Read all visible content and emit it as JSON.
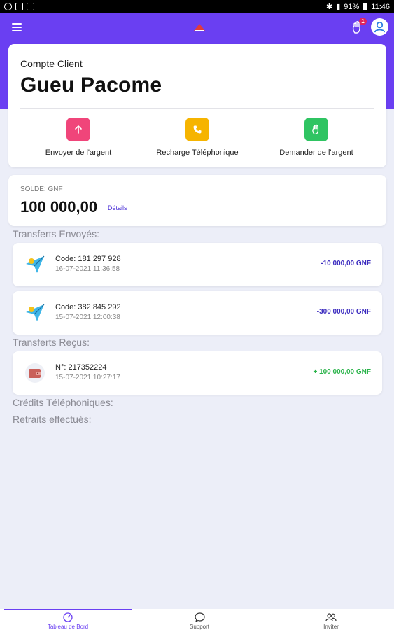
{
  "status_bar": {
    "left_icons": [
      "whatsapp-icon",
      "image-icon",
      "gmail-icon"
    ],
    "battery": "91%",
    "time": "11:46"
  },
  "header": {
    "menu_icon": "hamburger-icon",
    "logo": "app-logo",
    "notification_count": "1",
    "profile_icon": "user-icon"
  },
  "account": {
    "label": "Compte Client",
    "name": "Gueu Pacome",
    "actions": [
      {
        "label": "Envoyer de l'argent",
        "icon": "arrow-up-icon",
        "color": "#f0457a"
      },
      {
        "label": "Recharge Téléphonique",
        "icon": "phone-icon",
        "color": "#f6b400"
      },
      {
        "label": "Demander de l'argent",
        "icon": "hand-icon",
        "color": "#2fc462"
      }
    ]
  },
  "balance": {
    "label": "SOLDE: GNF",
    "amount": "100 000,00",
    "details_link": "Détails"
  },
  "sections": {
    "sent_title": "Transferts Envoyés:",
    "received_title": "Transferts Reçus:",
    "phone_credits_title": "Crédits Téléphoniques:",
    "withdrawals_title": "Retraits effectués:"
  },
  "sent_transfers": [
    {
      "code": "Code: 181 297 928",
      "date": "16-07-2021 11:36:58",
      "amount": "-10 000,00 GNF",
      "icon": "paper-plane-icon"
    },
    {
      "code": "Code: 382 845 292",
      "date": "15-07-2021 12:00:38",
      "amount": "-300 000,00 GNF",
      "icon": "paper-plane-icon"
    }
  ],
  "received_transfers": [
    {
      "code": "N°: 217352224",
      "date": "15-07-2021 10:27:17",
      "amount": "+ 100 000,00 GNF",
      "icon": "wallet-icon"
    }
  ],
  "bottom_nav": [
    {
      "label": "Tableau de Bord",
      "icon": "dashboard-icon",
      "active": true
    },
    {
      "label": "Support",
      "icon": "chat-icon",
      "active": false
    },
    {
      "label": "Inviter",
      "icon": "users-icon",
      "active": false
    }
  ],
  "colors": {
    "primary": "#6a3ff2",
    "background": "#eceef8",
    "sent_amount": "#3b2bbf",
    "received_amount": "#2ab34a"
  }
}
